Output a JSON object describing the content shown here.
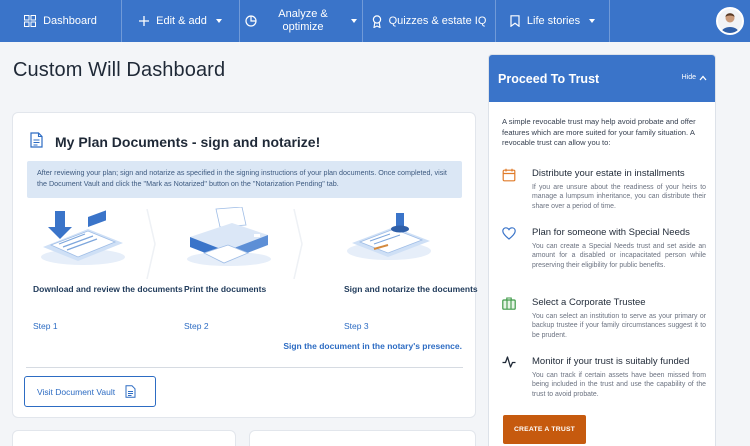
{
  "nav": {
    "items": [
      {
        "label": "Dashboard",
        "icon": "dashboard-grid-icon"
      },
      {
        "label": "Edit & add",
        "icon": "plus-icon"
      },
      {
        "label": "Analyze & optimize",
        "icon": "pie-chart-icon"
      },
      {
        "label": "Quizzes & estate IQ",
        "icon": "ribbon-award-icon"
      },
      {
        "label": "Life stories",
        "icon": "bookmark-icon"
      }
    ],
    "avatar_icon": "user-avatar-icon"
  },
  "page": {
    "title": "Custom Will Dashboard"
  },
  "documents": {
    "title": "My Plan Documents - sign and notarize!",
    "info": "After reviewing your plan; sign and notarize as specified in the signing instructions of your plan documents. Once completed, visit the Document Vault and click the \"Mark as Notarized\" button on the \"Notarization Pending\" tab.",
    "steps": [
      {
        "label": "Download and review the documents",
        "step": "Step 1"
      },
      {
        "label": "Print the documents",
        "step": "Step 2"
      },
      {
        "label": "Sign and notarize the documents",
        "step": "Step 3"
      }
    ],
    "sign_note": "Sign the document in the notary's presence.",
    "vault_button": "Visit Document Vault"
  },
  "trust": {
    "title": "Proceed To Trust",
    "hide_label": "Hide",
    "intro": "A simple revocable trust may help avoid probate and offer features which are more suited for your family situation. A revocable trust can allow you to:",
    "features": [
      {
        "icon": "calendar-icon",
        "title": "Distribute your estate in installments",
        "desc": "If you are unsure about the readiness of your heirs to manage a lumpsum inheritance, you can distribute their share over a period of time."
      },
      {
        "icon": "heart-icon",
        "title": "Plan for someone with Special Needs",
        "desc": "You can create a Special Needs trust and set aside an amount for a disabled or incapacitated person while preserving their eligibility for public benefits."
      },
      {
        "icon": "briefcase-icon",
        "title": "Select a Corporate Trustee",
        "desc": "You can select an institution to serve as your primary or backup trustee if your family circumstances suggest it to be prudent."
      },
      {
        "icon": "pulse-icon",
        "title": "Monitor if your trust is suitably funded",
        "desc": "You can track if certain assets have been missed from being included in the trust and use the capability of the trust to avoid probate."
      }
    ],
    "button": "CREATE A TRUST"
  },
  "colors": {
    "nav": "#3a74c9",
    "accent": "#2d6cc3",
    "cta": "#c65a0e"
  }
}
